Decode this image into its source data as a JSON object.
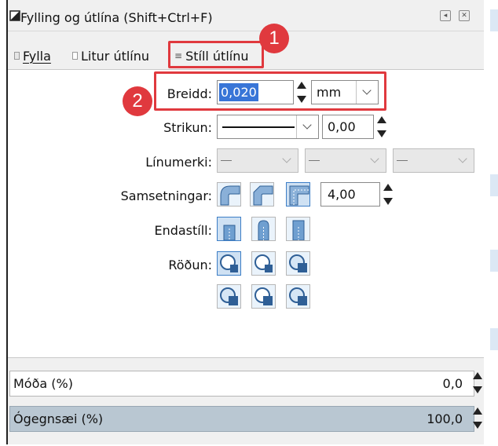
{
  "title": "Fylling og útlína (Shift+Ctrl+F)",
  "tabs": [
    {
      "label": "Fylla",
      "underline": "F"
    },
    {
      "label": "Litur útlínu"
    },
    {
      "label": "Stíll útlínu"
    }
  ],
  "badges": [
    "1",
    "2"
  ],
  "width": {
    "label": "Breidd:",
    "value": "0,020",
    "unit": "mm"
  },
  "dash": {
    "label": "Strikun:",
    "offset": "0,00"
  },
  "markers": {
    "label": "Línumerki:"
  },
  "join": {
    "label": "Samsetningar:",
    "miter": "4,00"
  },
  "cap": {
    "label": "Endastíll:"
  },
  "order": {
    "label": "Röðun:"
  },
  "blur": {
    "label": "Móða (%)",
    "value": "0,0"
  },
  "opacity": {
    "label": "Ógegnsæi (%)",
    "value": "100,0"
  },
  "colors": {
    "accent": "#e0393e",
    "selected": "#3d7ec6",
    "slate": "#b9c7d2"
  }
}
